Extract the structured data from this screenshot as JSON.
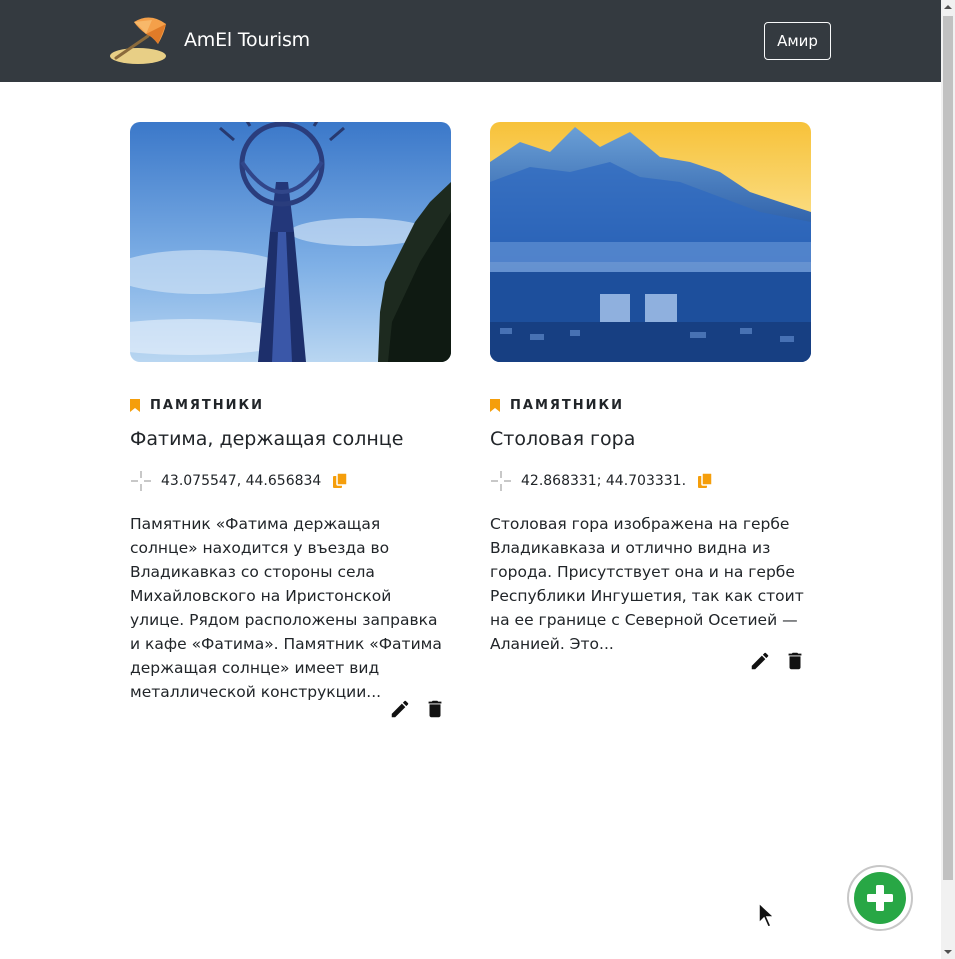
{
  "navbar": {
    "brand_name": "AmEl Tourism",
    "user_button": "Амир",
    "bg_color": "#343a40"
  },
  "cards": [
    {
      "category": "ПАМЯТНИКИ",
      "title": "Фатима, держащая солнце",
      "coordinates": "43.075547, 44.656834",
      "text": "Памятник «Фатима держащая солнце» находится у въезда во Владикавказ со стороны села Михайловского на Иристонской улице. Рядом расположены заправка и кафе «Фатима». Памятник «Фатима держащая солнце» имеет вид металлической конструкции...",
      "image": "monument-photo"
    },
    {
      "category": "ПАМЯТНИКИ",
      "title": "Столовая гора",
      "coordinates": "42.868331; 44.703331.",
      "text": "Столовая гора изображена на гербе Владикавказа и отлично видна из города. Присутствует она и на гербе Республики Ингушетия, так как стоит на ее границе с Северной Осетией — Аланией. Это...",
      "image": "mountain-photo"
    }
  ],
  "icons": {
    "bookmark": "bookmark-icon",
    "coordinates": "crosshair-icon",
    "copy": "copy-icon",
    "edit": "pencil-icon",
    "delete": "trash-icon",
    "add": "plus-icon"
  },
  "colors": {
    "accent": "#f59e0b",
    "fab_green": "#28a745"
  }
}
